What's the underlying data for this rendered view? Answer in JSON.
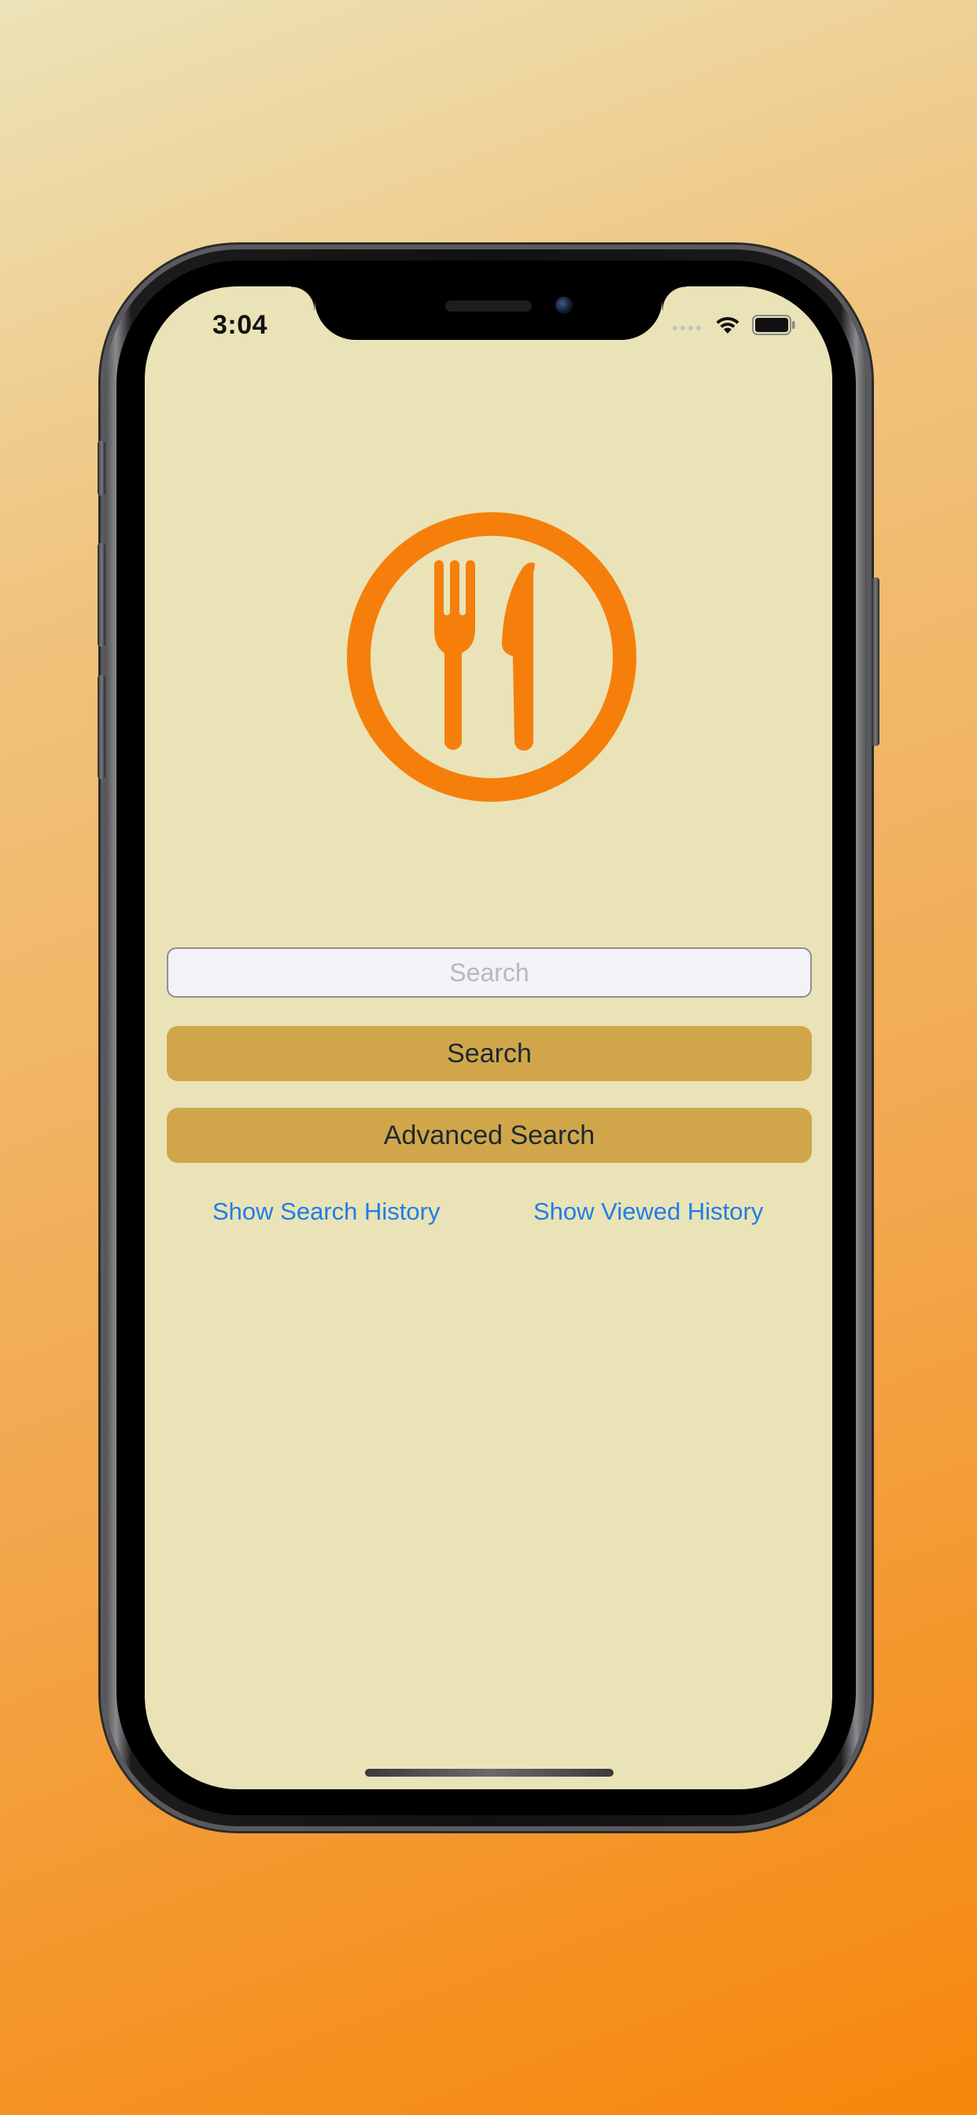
{
  "status_bar": {
    "time": "3:04"
  },
  "colors": {
    "screen_background": "#eae3b8",
    "logo_orange": "#f57f0a",
    "button_gold": "#d1a64b",
    "link_blue": "#1e7ee6"
  },
  "logo": {
    "icon": "fork-and-knife-plate-icon"
  },
  "search": {
    "placeholder": "Search",
    "value": ""
  },
  "buttons": {
    "search_label": "Search",
    "advanced_search_label": "Advanced Search"
  },
  "links": {
    "search_history": "Show Search History",
    "viewed_history": "Show Viewed History"
  }
}
